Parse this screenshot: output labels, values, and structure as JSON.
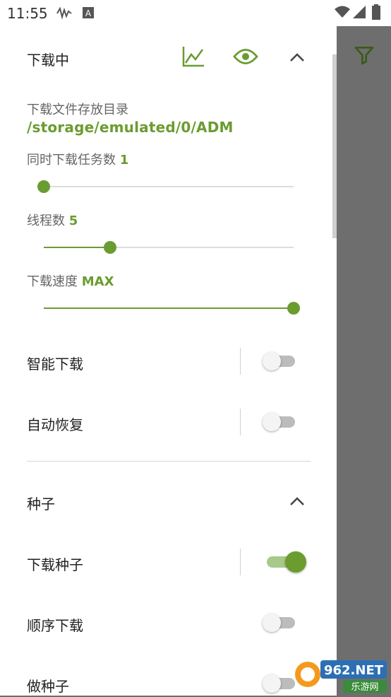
{
  "status_bar": {
    "time": "11:55",
    "icons": [
      "signal-wave-icon",
      "a-box-icon",
      "wifi-icon",
      "cell-signal-icon",
      "battery-icon"
    ]
  },
  "downloading": {
    "title": "下载中",
    "icons": [
      "chart-icon",
      "eye-icon",
      "chevron-up-icon"
    ],
    "dir_label": "下载文件存放目录",
    "dir_value": "/storage/emulated/0/ADM",
    "concurrent_label": "同时下载任务数",
    "concurrent_value": "1",
    "concurrent_level": 0.0,
    "threads_label": "线程数",
    "threads_value": "5",
    "threads_level": 0.265,
    "speed_label": "下载速度",
    "speed_value": "MAX",
    "speed_level": 1.0,
    "smart_download": "智能下载",
    "smart_download_on": false,
    "auto_resume": "自动恢复",
    "auto_resume_on": false
  },
  "torrent": {
    "title": "种子",
    "download_torrent": "下载种子",
    "download_torrent_on": true,
    "sequential_download": "顺序下载",
    "sequential_download_on": false,
    "make_torrent": "做种子",
    "make_torrent_on": false
  },
  "side": {
    "filter_icon": "filter-icon"
  },
  "watermark": {
    "text_top": "962.NET",
    "text_bottom": "乐游网"
  },
  "colors": {
    "accent": "#6a9c30",
    "scrim": "#6e6e6e"
  }
}
